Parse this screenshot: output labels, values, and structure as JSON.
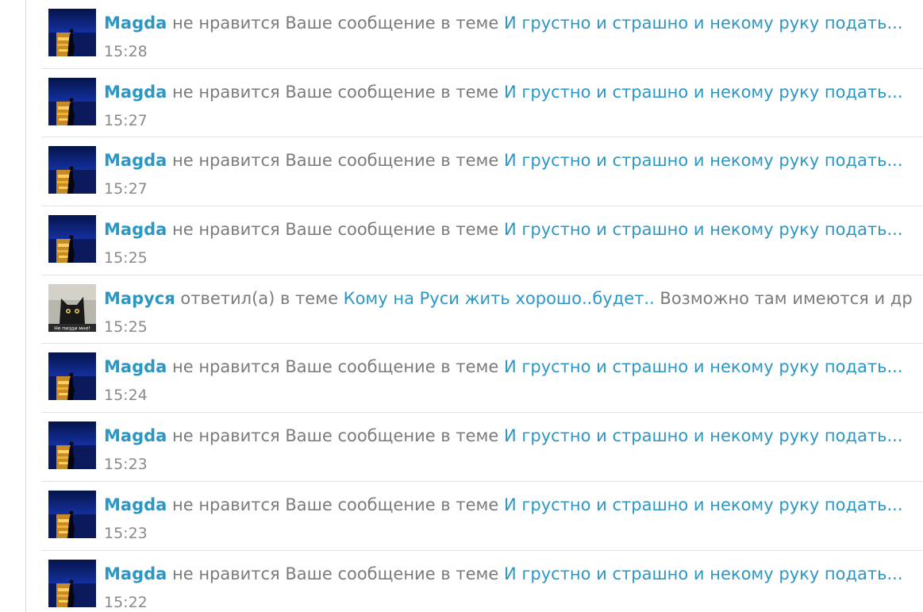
{
  "colors": {
    "link": "#2d97c4",
    "text": "#7b7b7b",
    "time": "#8a8a8a",
    "divider": "#e3e3e3"
  },
  "feed": {
    "items": [
      {
        "avatar": "sunset-silhouette",
        "user": "Magda",
        "action": " не нравится Ваше сообщение в теме ",
        "topic": "И грустно и страшно и некому руку подать...",
        "extra": "",
        "time": "15:28"
      },
      {
        "avatar": "sunset-silhouette",
        "user": "Magda",
        "action": " не нравится Ваше сообщение в теме ",
        "topic": "И грустно и страшно и некому руку подать...",
        "extra": "",
        "time": "15:27"
      },
      {
        "avatar": "sunset-silhouette",
        "user": "Magda",
        "action": " не нравится Ваше сообщение в теме ",
        "topic": "И грустно и страшно и некому руку подать...",
        "extra": "",
        "time": "15:27"
      },
      {
        "avatar": "sunset-silhouette",
        "user": "Magda",
        "action": " не нравится Ваше сообщение в теме ",
        "topic": "И грустно и страшно и некому руку подать...",
        "extra": "",
        "time": "15:25"
      },
      {
        "avatar": "black-cat",
        "avatar_caption": "Не пизди мне!",
        "user": "Маруся",
        "action": " ответил(а) в теме ",
        "topic": "Кому на Руси жить хорошо..будет..",
        "extra": " Возможно там имеются и др",
        "time": "15:25"
      },
      {
        "avatar": "sunset-silhouette",
        "user": "Magda",
        "action": " не нравится Ваше сообщение в теме ",
        "topic": "И грустно и страшно и некому руку подать...",
        "extra": "",
        "time": "15:24"
      },
      {
        "avatar": "sunset-silhouette",
        "user": "Magda",
        "action": " не нравится Ваше сообщение в теме ",
        "topic": "И грустно и страшно и некому руку подать...",
        "extra": "",
        "time": "15:23"
      },
      {
        "avatar": "sunset-silhouette",
        "user": "Magda",
        "action": " не нравится Ваше сообщение в теме ",
        "topic": "И грустно и страшно и некому руку подать...",
        "extra": "",
        "time": "15:23"
      },
      {
        "avatar": "sunset-silhouette",
        "user": "Magda",
        "action": " не нравится Ваше сообщение в теме ",
        "topic": "И грустно и страшно и некому руку подать...",
        "extra": "",
        "time": "15:22"
      }
    ]
  }
}
